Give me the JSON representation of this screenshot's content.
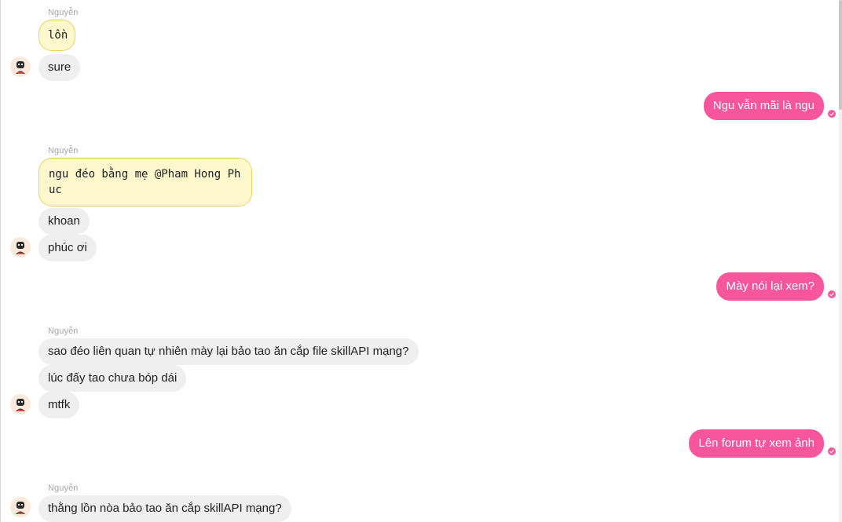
{
  "colors": {
    "outgoing_bubble": "#f7559c",
    "incoming_bubble": "#efefef",
    "highlight_bubble": "#fff8cc",
    "highlight_border": "#f0d060",
    "sender_name": "#a6a6a6"
  },
  "groups": [
    {
      "sender": "Nguyễn",
      "messages": [
        "lồn",
        "sure"
      ]
    },
    {
      "sender": "Nguyễn",
      "messages": [
        "ngu đéo bằng mẹ @Pham Hong Phuc",
        "khoan",
        "phúc ơi"
      ]
    },
    {
      "sender": "Nguyễn",
      "messages": [
        "sao đéo liên quan tự nhiên mày lại bảo tao ăn cắp file skillAPI mạng?",
        "lúc đấy tao chưa bóp dái",
        "mtfk"
      ]
    },
    {
      "sender": "Nguyễn",
      "messages": [
        "thằng lồn nòa bảo tao ăn cắp skillAPI mạng?"
      ]
    }
  ],
  "outgoing": [
    "Ngu vẫn mãi là ngu",
    "Mày nói lại xem?",
    "Lên forum tự xem ảnh"
  ],
  "icons": {
    "avatar": "avatar-icon",
    "seen": "seen-check-icon"
  }
}
